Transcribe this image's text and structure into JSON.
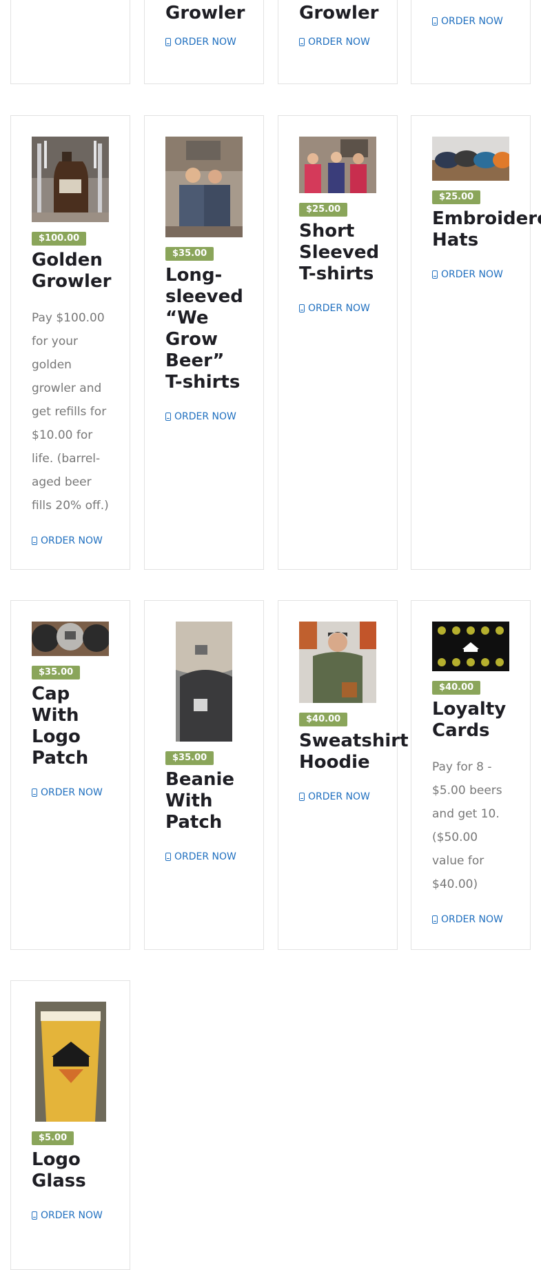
{
  "order_label": "ORDER NOW",
  "top_row": [
    {
      "title": null
    },
    {
      "title": "Growler"
    },
    {
      "title": "Growler"
    },
    {
      "title": null
    }
  ],
  "products": [
    {
      "price": "$100.00",
      "title": "Golden Growler",
      "description": "Pay $100.00 for your golden growler and get refills for $10.00 for life. (barrel-aged beer fills 20% off.)",
      "image": "growler-photo"
    },
    {
      "price": "$35.00",
      "title": "Long-sleeved “We Grow Beer” T-shirts",
      "description": null,
      "image": "longsleeve-photo"
    },
    {
      "price": "$25.00",
      "title": "Short Sleeved T-shirts",
      "description": null,
      "image": "tshirt-photo"
    },
    {
      "price": "$25.00",
      "title": "Embroidered Hats",
      "description": null,
      "image": "hats-photo"
    },
    {
      "price": "$35.00",
      "title": "Cap With Logo Patch",
      "description": null,
      "image": "caps-photo"
    },
    {
      "price": "$35.00",
      "title": "Beanie With Patch",
      "description": null,
      "image": "beanie-photo"
    },
    {
      "price": "$40.00",
      "title": "Sweatshirt Hoodie",
      "description": null,
      "image": "hoodie-photo"
    },
    {
      "price": "$40.00",
      "title": "Loyalty Cards",
      "description": "Pay for 8 - $5.00 beers and get 10. ($50.00 value for $40.00)",
      "image": "loyalty-card-photo"
    },
    {
      "price": "$5.00",
      "title": "Logo Glass",
      "description": null,
      "image": "logo-glass-photo"
    }
  ],
  "colors": {
    "accent_link": "#1f6fbf",
    "price_badge": "#8aa55a",
    "border": "#e2e2e2"
  }
}
